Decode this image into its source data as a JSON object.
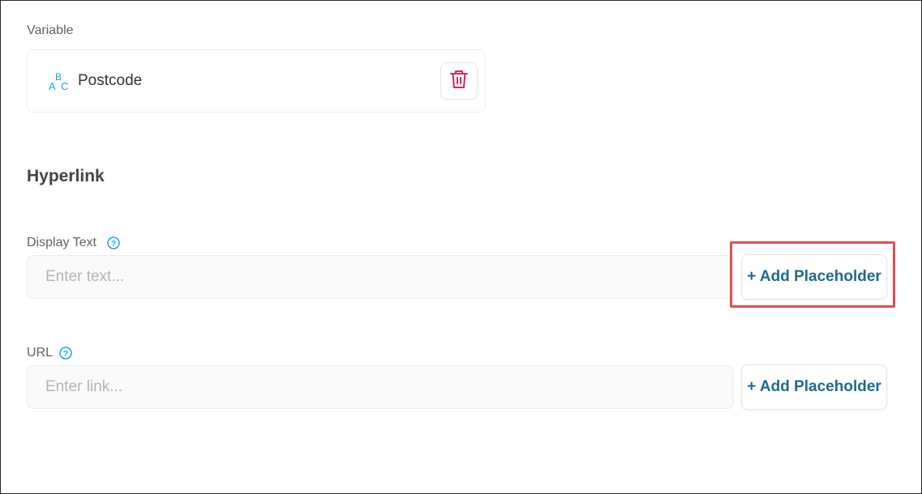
{
  "variable": {
    "label": "Variable",
    "name": "Postcode",
    "type_icon": "abc-text-icon",
    "delete_icon": "trash-icon"
  },
  "hyperlink": {
    "title": "Hyperlink",
    "display_text": {
      "label": "Display Text",
      "help_icon": "question-circle-icon",
      "placeholder": "Enter text...",
      "value": "",
      "add_button": "+ Add Placeholder",
      "highlighted": true
    },
    "url": {
      "label": "URL",
      "help_icon": "question-circle-icon",
      "placeholder": "Enter link...",
      "value": "",
      "add_button": "+ Add Placeholder"
    }
  },
  "colors": {
    "accent": "#1e6b8f",
    "icon_cyan": "#1aa6d6",
    "delete_red": "#d8275e",
    "highlight_red": "#e0504f"
  }
}
